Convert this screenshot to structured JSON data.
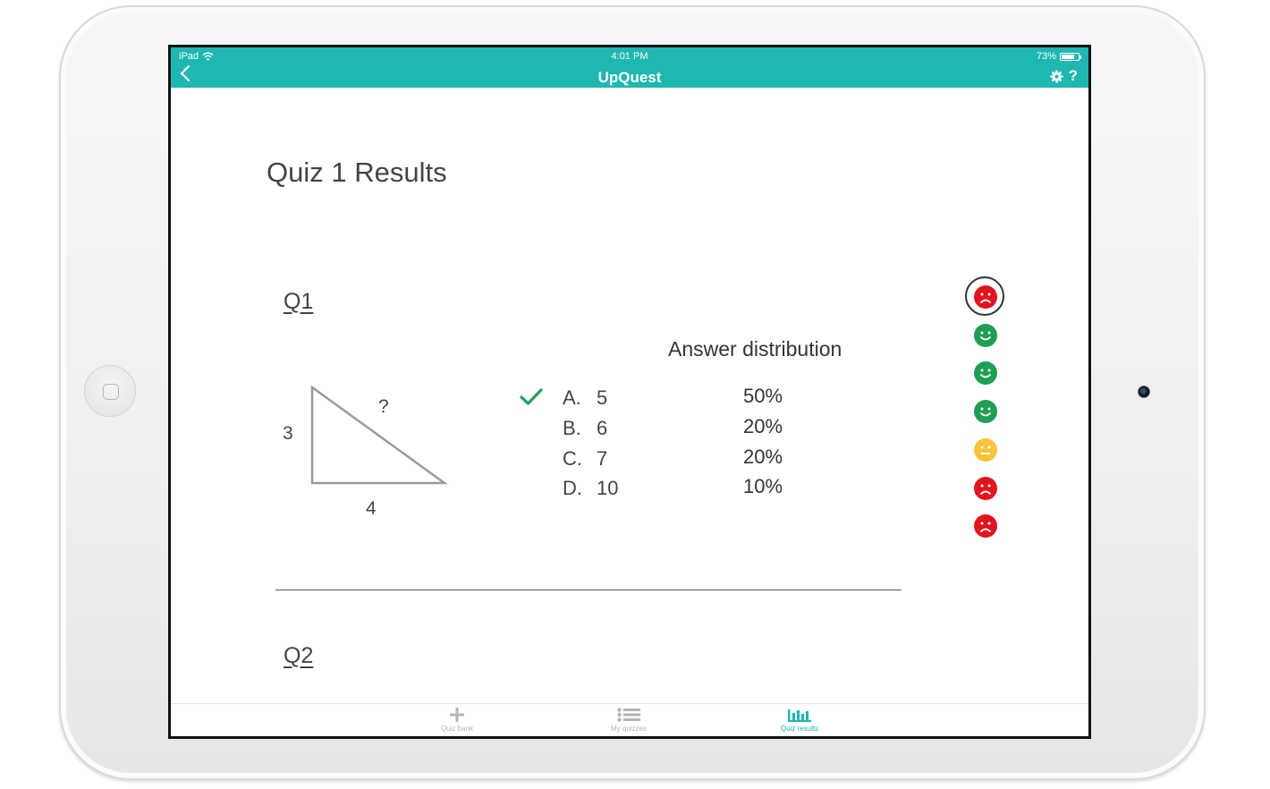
{
  "status_bar": {
    "device": "iPad",
    "time": "4:01 PM",
    "battery": "73%"
  },
  "header": {
    "title": "UpQuest",
    "settings_icon": "gear-icon",
    "help_label": "?"
  },
  "page": {
    "title": "Quiz 1 Results"
  },
  "questions": [
    {
      "label": "Q1",
      "figure": {
        "side_left": "3",
        "side_bottom": "4",
        "hypotenuse": "?"
      },
      "distribution_heading": "Answer distribution",
      "options": [
        {
          "letter": "A.",
          "value": "5",
          "percent": "50%",
          "correct": true
        },
        {
          "letter": "B.",
          "value": "6",
          "percent": "20%",
          "correct": false
        },
        {
          "letter": "C.",
          "value": "7",
          "percent": "20%",
          "correct": false
        },
        {
          "letter": "D.",
          "value": "10",
          "percent": "10%",
          "correct": false
        }
      ]
    },
    {
      "label": "Q2"
    }
  ],
  "student_faces": [
    {
      "mood": "sad",
      "color": "#e3141f",
      "selected": true
    },
    {
      "mood": "happy",
      "color": "#1f9e52",
      "selected": false
    },
    {
      "mood": "happy",
      "color": "#1f9e52",
      "selected": false
    },
    {
      "mood": "happy",
      "color": "#1f9e52",
      "selected": false
    },
    {
      "mood": "neutral",
      "color": "#f6c33b",
      "selected": false
    },
    {
      "mood": "sad",
      "color": "#e3141f",
      "selected": false
    },
    {
      "mood": "sad",
      "color": "#e3141f",
      "selected": false
    }
  ],
  "tabs": [
    {
      "label": "Quiz bank",
      "icon": "plus-icon",
      "active": false
    },
    {
      "label": "My quizzes",
      "icon": "list-icon",
      "active": false
    },
    {
      "label": "Quiz results",
      "icon": "bar-chart-icon",
      "active": true
    }
  ],
  "colors": {
    "accent": "#1fb7b1",
    "correct": "#1f9e52"
  }
}
